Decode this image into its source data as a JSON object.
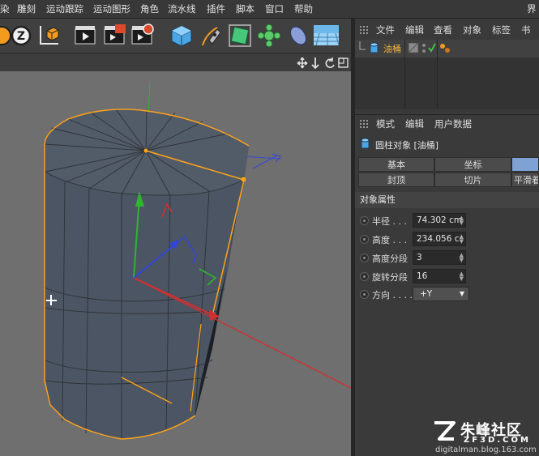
{
  "menu": {
    "items": [
      "染",
      "雕刻",
      "运动跟踪",
      "运动图形",
      "角色",
      "流水线",
      "插件",
      "脚本",
      "窗口",
      "帮助"
    ],
    "right_edge": "界"
  },
  "objects_panel": {
    "tabs": [
      "文件",
      "编辑",
      "查看",
      "对象",
      "标签",
      "书签"
    ],
    "object_name": "油桶"
  },
  "attributes_panel": {
    "tabs": [
      "模式",
      "编辑",
      "用户数据"
    ],
    "object_title": "圆柱对象 [油桶]",
    "prop_tabs": [
      [
        "基本",
        "坐标",
        ""
      ],
      [
        "封顶",
        "切片",
        "平滑着"
      ]
    ],
    "section": "对象属性",
    "props": [
      {
        "label": "半径 . . .",
        "value": "74.302 cm"
      },
      {
        "label": "高度 . . .",
        "value": "234.056 c"
      },
      {
        "label": "高度分段",
        "value": "3"
      },
      {
        "label": "旋转分段",
        "value": "16"
      },
      {
        "label": "方向 . . . .",
        "value": "+Y"
      }
    ]
  },
  "watermark": {
    "brand": "朱峰社区",
    "domain": "ZF3D.COM",
    "url": "digitalman.blog.163.com"
  },
  "colors": {
    "viewport_bg": "#6f6f6f",
    "selection_orange": "#ffa31a",
    "axis_x": "#d13030",
    "axis_y": "#2fb52f",
    "axis_z": "#3346d8"
  }
}
